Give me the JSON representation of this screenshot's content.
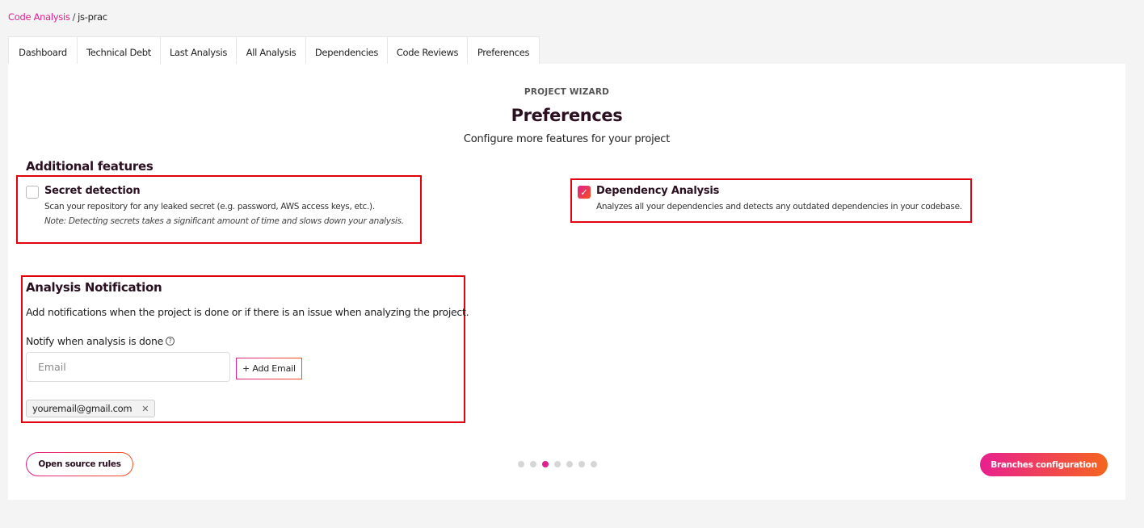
{
  "breadcrumb": {
    "root": "Code Analysis",
    "separator": "/",
    "current": "js-prac"
  },
  "tabs": [
    {
      "label": "Dashboard"
    },
    {
      "label": "Technical Debt"
    },
    {
      "label": "Last Analysis"
    },
    {
      "label": "All Analysis"
    },
    {
      "label": "Dependencies"
    },
    {
      "label": "Code Reviews"
    },
    {
      "label": "Preferences"
    }
  ],
  "wizard": {
    "eyebrow": "PROJECT WIZARD",
    "title": "Preferences",
    "subtitle": "Configure more features for your project"
  },
  "additional_features": {
    "heading": "Additional features",
    "secret_detection": {
      "title": "Secret detection",
      "checked": false,
      "description": "Scan your repository for any leaked secret (e.g. password, AWS access keys, etc.).",
      "note": "Note: Detecting secrets takes a significant amount of time and slows down your analysis."
    },
    "dependency_analysis": {
      "title": "Dependency Analysis",
      "checked": true,
      "description": "Analyzes all your dependencies and detects any outdated dependencies in your codebase."
    }
  },
  "analysis_notification": {
    "heading": "Analysis Notification",
    "description": "Add notifications when the project is done or if there is an issue when analyzing the project.",
    "notify_label": "Notify when analysis is done",
    "email_input": {
      "value": "",
      "placeholder": "Email"
    },
    "add_email_label": "+ Add Email",
    "emails": [
      "youremail@gmail.com"
    ]
  },
  "footer": {
    "open_source_rules_label": "Open source rules",
    "branches_configuration_label": "Branches configuration",
    "steps_total": 7,
    "current_step": 3
  },
  "colors": {
    "accent": "#e0208f",
    "accent_end": "#f4511e",
    "highlight": "#e3000f"
  }
}
